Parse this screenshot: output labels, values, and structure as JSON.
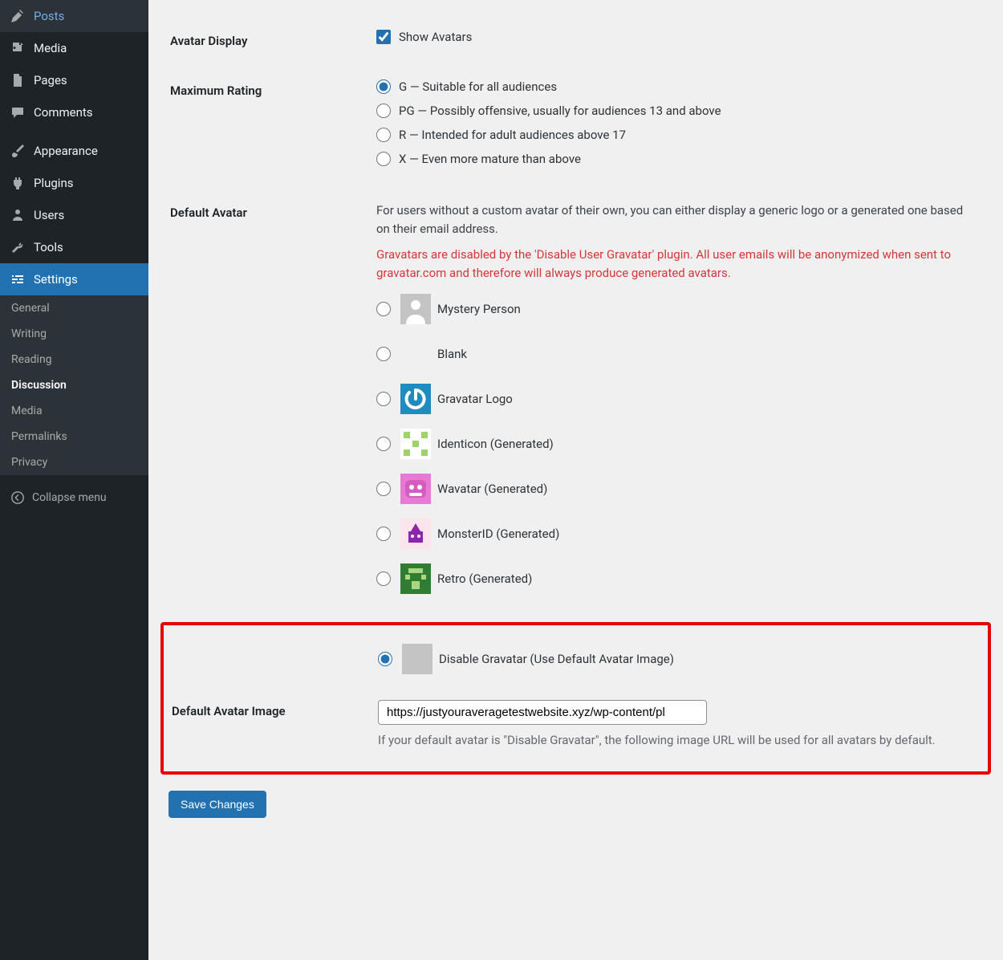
{
  "sidebar": {
    "items": [
      {
        "label": "Posts"
      },
      {
        "label": "Media"
      },
      {
        "label": "Pages"
      },
      {
        "label": "Comments"
      },
      {
        "label": "Appearance"
      },
      {
        "label": "Plugins"
      },
      {
        "label": "Users"
      },
      {
        "label": "Tools"
      },
      {
        "label": "Settings"
      }
    ],
    "submenu": [
      {
        "label": "General"
      },
      {
        "label": "Writing"
      },
      {
        "label": "Reading"
      },
      {
        "label": "Discussion"
      },
      {
        "label": "Media"
      },
      {
        "label": "Permalinks"
      },
      {
        "label": "Privacy"
      }
    ],
    "collapse": "Collapse menu"
  },
  "settings": {
    "avatar_display": {
      "heading": "Avatar Display",
      "checkbox_label": "Show Avatars",
      "checked": true
    },
    "maximum_rating": {
      "heading": "Maximum Rating",
      "options": [
        {
          "label": "G — Suitable for all audiences"
        },
        {
          "label": "PG — Possibly offensive, usually for audiences 13 and above"
        },
        {
          "label": "R — Intended for adult audiences above 17"
        },
        {
          "label": "X — Even more mature than above"
        }
      ],
      "selected_index": 0
    },
    "default_avatar": {
      "heading": "Default Avatar",
      "description": "For users without a custom avatar of their own, you can either display a generic logo or a generated one based on their email address.",
      "warning": "Gravatars are disabled by the 'Disable User Gravatar' plugin. All user emails will be anonymized when sent to gravatar.com and therefore will always produce generated avatars.",
      "options": [
        {
          "label": "Mystery Person"
        },
        {
          "label": "Blank"
        },
        {
          "label": "Gravatar Logo"
        },
        {
          "label": "Identicon (Generated)"
        },
        {
          "label": "Wavatar (Generated)"
        },
        {
          "label": "MonsterID (Generated)"
        },
        {
          "label": "Retro (Generated)"
        },
        {
          "label": "Disable Gravatar (Use Default Avatar Image)"
        }
      ],
      "selected_index": 7
    },
    "default_avatar_image": {
      "heading": "Default Avatar Image",
      "value": "https://justyouraveragetestwebsite.xyz/wp-content/pl",
      "help": "If your default avatar is \"Disable Gravatar\", the following image URL will be used for all avatars by default."
    },
    "save_label": "Save Changes"
  }
}
